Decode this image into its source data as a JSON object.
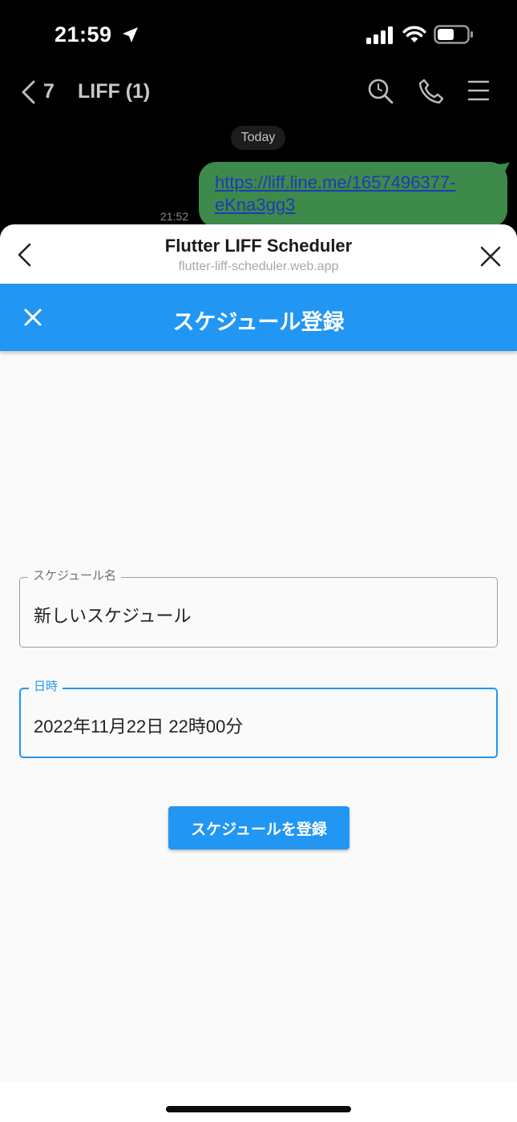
{
  "status_bar": {
    "time": "21:59",
    "icons": [
      "location-arrow-icon",
      "signal-icon",
      "wifi-icon",
      "battery-icon"
    ]
  },
  "chat_header": {
    "back_count": "7",
    "title": "LIFF (1)",
    "icons": [
      "search-icon",
      "phone-icon",
      "menu-icon"
    ]
  },
  "chat": {
    "date_label": "Today",
    "message": {
      "time": "21:52",
      "link_line1": "https://liff.line.me/1657496377-",
      "link_line2": "eKna3gg3"
    }
  },
  "liff_bar": {
    "title": "Flutter LIFF Scheduler",
    "url": "flutter-liff-scheduler.web.app"
  },
  "app_bar": {
    "title": "スケジュール登録"
  },
  "form": {
    "name_field": {
      "label": "スケジュール名",
      "value": "新しいスケジュール"
    },
    "date_field": {
      "label": "日時",
      "value": "2022年11月22日 22時00分"
    },
    "submit_label": "スケジュールを登録"
  },
  "colors": {
    "accent": "#2196f3",
    "bubble": "#3d8a4a",
    "link": "#1d3bb8"
  }
}
